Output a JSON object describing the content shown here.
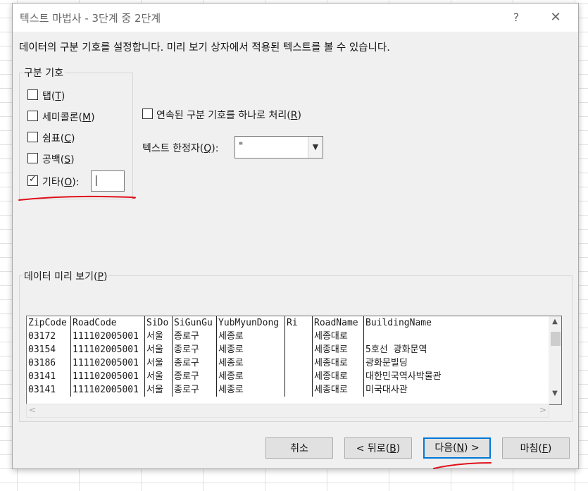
{
  "window": {
    "title": "텍스트 마법사 - 3단계 중 2단계",
    "help": "?",
    "close": "✕"
  },
  "description": "데이터의 구분 기호를 설정합니다. 미리 보기 상자에서 적용된 텍스트를 볼 수 있습니다.",
  "delimiters": {
    "legend": "구분 기호",
    "items": [
      {
        "text": "탭(",
        "key": "T",
        "end": ")",
        "checked": false
      },
      {
        "text": "세미콜론(",
        "key": "M",
        "end": ")",
        "checked": false
      },
      {
        "text": "쉼표(",
        "key": "C",
        "end": ")",
        "checked": false
      },
      {
        "text": "공백(",
        "key": "S",
        "end": ")",
        "checked": false
      },
      {
        "text": "기타(",
        "key": "O",
        "end": "):",
        "checked": true
      }
    ],
    "other_value": ""
  },
  "consecutive": {
    "text": "연속된 구분 기호를 하나로 처리(",
    "key": "R",
    "end": ")",
    "checked": false
  },
  "qualifier": {
    "text": "텍스트 한정자(",
    "key": "Q",
    "end": "):",
    "value": "\""
  },
  "preview": {
    "legend_text": "데이터 미리 보기(",
    "legend_key": "P",
    "legend_end": ")",
    "rows": [
      [
        "ZipCode",
        "RoadCode",
        "SiDo",
        "SiGunGu",
        "YubMyunDong",
        "Ri",
        "RoadName",
        "BuildingName"
      ],
      [
        "03172",
        "111102005001",
        "서울",
        "종로구",
        "세종로",
        "",
        "세종대로",
        ""
      ],
      [
        "03154",
        "111102005001",
        "서울",
        "종로구",
        "세종로",
        "",
        "세종대로",
        "5호선 광화문역"
      ],
      [
        "03186",
        "111102005001",
        "서울",
        "종로구",
        "세종로",
        "",
        "세종대로",
        "광화문빌딩"
      ],
      [
        "03141",
        "111102005001",
        "서울",
        "종로구",
        "세종로",
        "",
        "세종대로",
        "대한민국역사박물관"
      ],
      [
        "03141",
        "111102005001",
        "서울",
        "종로구",
        "세종로",
        "",
        "세종대로",
        "미국대사관"
      ]
    ]
  },
  "buttons": {
    "cancel": "취소",
    "back_text": "< 뒤로(",
    "back_key": "B",
    "back_end": ")",
    "next_text": "다음(",
    "next_key": "N",
    "next_end": ") >",
    "finish_text": "마침(",
    "finish_key": "F",
    "finish_end": ")"
  },
  "colors": {
    "annotation": "#e0121b",
    "focus": "#0078d7"
  },
  "icons": {
    "check": "check-icon",
    "dropdown": "chevron-down-icon",
    "close": "close-icon"
  }
}
